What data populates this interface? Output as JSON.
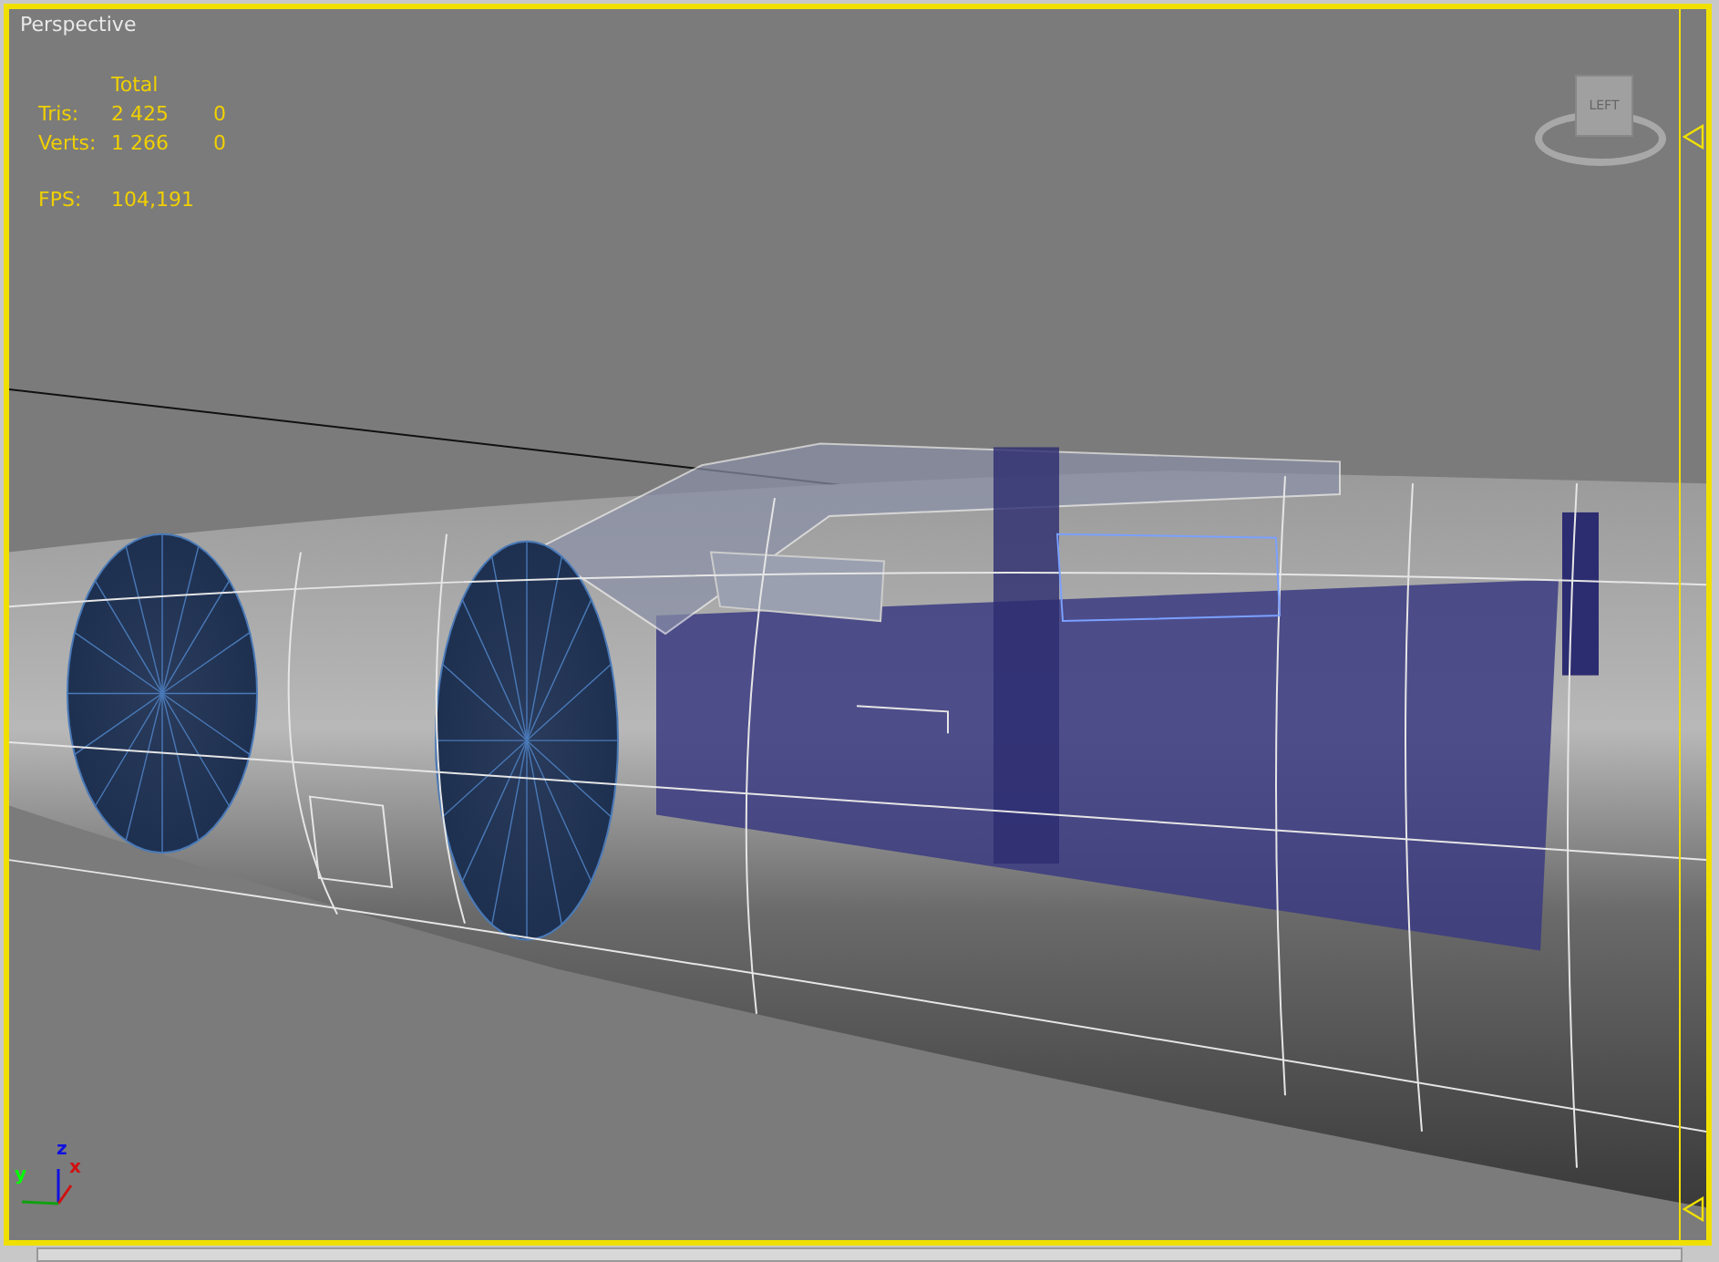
{
  "viewport": {
    "label": "Perspective"
  },
  "stats": {
    "header": "Total",
    "rows": [
      {
        "label": "Tris:",
        "total": "2 425",
        "selection": "0"
      },
      {
        "label": "Verts:",
        "total": "1 266",
        "selection": "0"
      }
    ],
    "fps": {
      "label": "FPS:",
      "value": "104,191"
    }
  },
  "viewcube": {
    "face": "LEFT"
  },
  "axis_gizmo": {
    "z": "z",
    "x": "x",
    "y": "y"
  }
}
